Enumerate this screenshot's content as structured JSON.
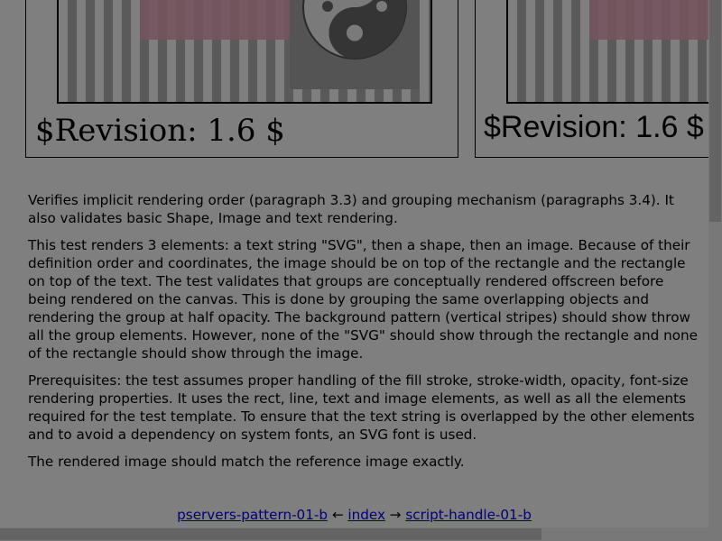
{
  "preview": {
    "test_revision": "$Revision: 1.6 $",
    "reference_revision": "$Revision: 1.6 $",
    "image_icon": "yin-yang-icon"
  },
  "description": {
    "paragraphs": [
      "Verifies implicit rendering order (paragraph 3.3) and grouping mechanism (paragraphs 3.4). It also validates basic Shape, Image and text rendering.",
      "This test renders 3 elements: a text string \"SVG\", then a shape, then an image. Because of their definition order and coordinates, the image should be on top of the rectangle and the rectangle on top of the text. The test validates that groups are conceptually rendered offscreen before being rendered on the canvas. This is done by grouping the same overlapping objects and rendering the group at half opacity. The background pattern (vertical stripes) should show throw all the group elements. However, none of the \"SVG\" should show through the rectangle and none of the rectangle should show through the image.",
      "Prerequisites: the test assumes proper handling of the fill stroke, stroke-width, opacity, font-size rendering properties. It uses the rect, line, text and image elements, as well as all the elements required for the test template. To ensure that the text string is overlapped by the other elements and to avoid a dependency on system fonts, an SVG font is used.",
      "The rendered image should match the reference image exactly."
    ]
  },
  "nav": {
    "prev": "pservers-pattern-01-b",
    "prev_arrow": "←",
    "index": "index",
    "next_arrow": "→",
    "next": "script-handle-01-b"
  },
  "colors": {
    "stripe_gray": "#b4b4b4",
    "rect_pink": "#e8a8bc",
    "link_blue": "#0000ee",
    "overlay": "rgba(0,0,0,0.5)"
  }
}
